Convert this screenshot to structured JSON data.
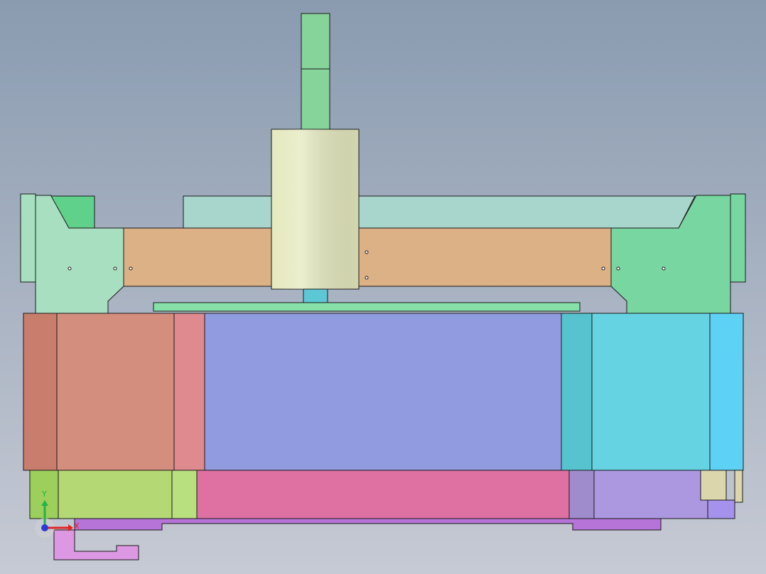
{
  "view": {
    "background_top": "#8a9bb0",
    "background_bottom": "#c6cad4",
    "outline_color": "#1a1a1a"
  },
  "parts": {
    "spindle_motor": "#87d49a",
    "spindle_body": "#e4e9be",
    "spindle_collet": "#5cc8d6",
    "gantry_beam": "#dcb185",
    "gantry_top_rail": "#a8d6cd",
    "gantry_side_plate_left": "#a8dfc1",
    "gantry_side_plate_right": "#78d6a0",
    "linear_rail_tab": "#5fd18b",
    "tool_rail": "#86e0a8",
    "base_block_1": "#c97d6c",
    "base_block_2": "#d48e7e",
    "base_block_3": "#de8a8e",
    "work_table": "#919be0",
    "base_block_4": "#56c3cf",
    "base_block_5": "#66d3e3",
    "base_block_6": "#5ed2f5",
    "lower_block_1": "#9ccf5c",
    "lower_block_2": "#b3d874",
    "lower_block_3": "#b9e07e",
    "lower_drawer": "#de70a2",
    "lower_block_4": "#9f8ccc",
    "lower_block_5": "#ac98e0",
    "lower_block_6": "#a592ec",
    "lower_pad": "#dcd6ad",
    "foot_plate": "#b774d8",
    "foot_bracket": "#dc98e2"
  },
  "triad": {
    "x_label": "X",
    "y_label": "Y",
    "x_color": "#e52222",
    "y_color": "#22b34a",
    "z_color": "#2a3bd8"
  }
}
